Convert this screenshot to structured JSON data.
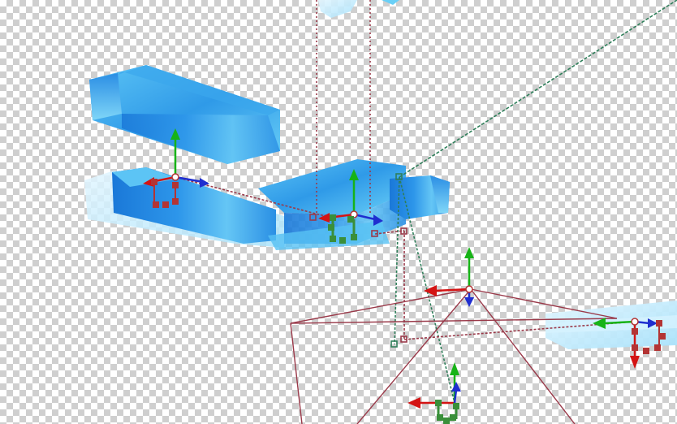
{
  "editor": {
    "background": "transparency-checkerboard",
    "checker_colors": [
      "#ffffff",
      "#cfcfcf"
    ]
  },
  "colors": {
    "axis_x": "#d41414",
    "axis_y": "#17b317",
    "axis_z": "#1f2ed0",
    "bone_line": "#9a3a4a",
    "guide_line": "#2f7f5a",
    "handle_red": "#b33434",
    "handle_green": "#3a8f3a",
    "block_light": "#bfe9ff",
    "block_mid": "#4fb7f2",
    "block_dark": "#1a78d8"
  },
  "objects": [
    {
      "name": "upper-blue-block",
      "kind": "mesh"
    },
    {
      "name": "lower-left-blue-block",
      "kind": "mesh"
    },
    {
      "name": "center-blue-block",
      "kind": "mesh"
    },
    {
      "name": "right-pale-block",
      "kind": "mesh"
    },
    {
      "name": "top-pale-block",
      "kind": "mesh"
    }
  ],
  "gizmos": [
    {
      "name": "left-block-gizmo",
      "icon": "move-gizmo-icon",
      "handle": "red-selection-square"
    },
    {
      "name": "center-gizmo",
      "icon": "move-gizmo-icon",
      "handle": "green-selection-square"
    },
    {
      "name": "frame-apex-gizmo",
      "icon": "move-gizmo-icon",
      "handle": "none"
    },
    {
      "name": "right-gizmo",
      "icon": "move-gizmo-icon",
      "handle": "red-selection-square"
    },
    {
      "name": "bottom-gizmo",
      "icon": "move-gizmo-icon",
      "handle": "green-selection-square"
    }
  ]
}
